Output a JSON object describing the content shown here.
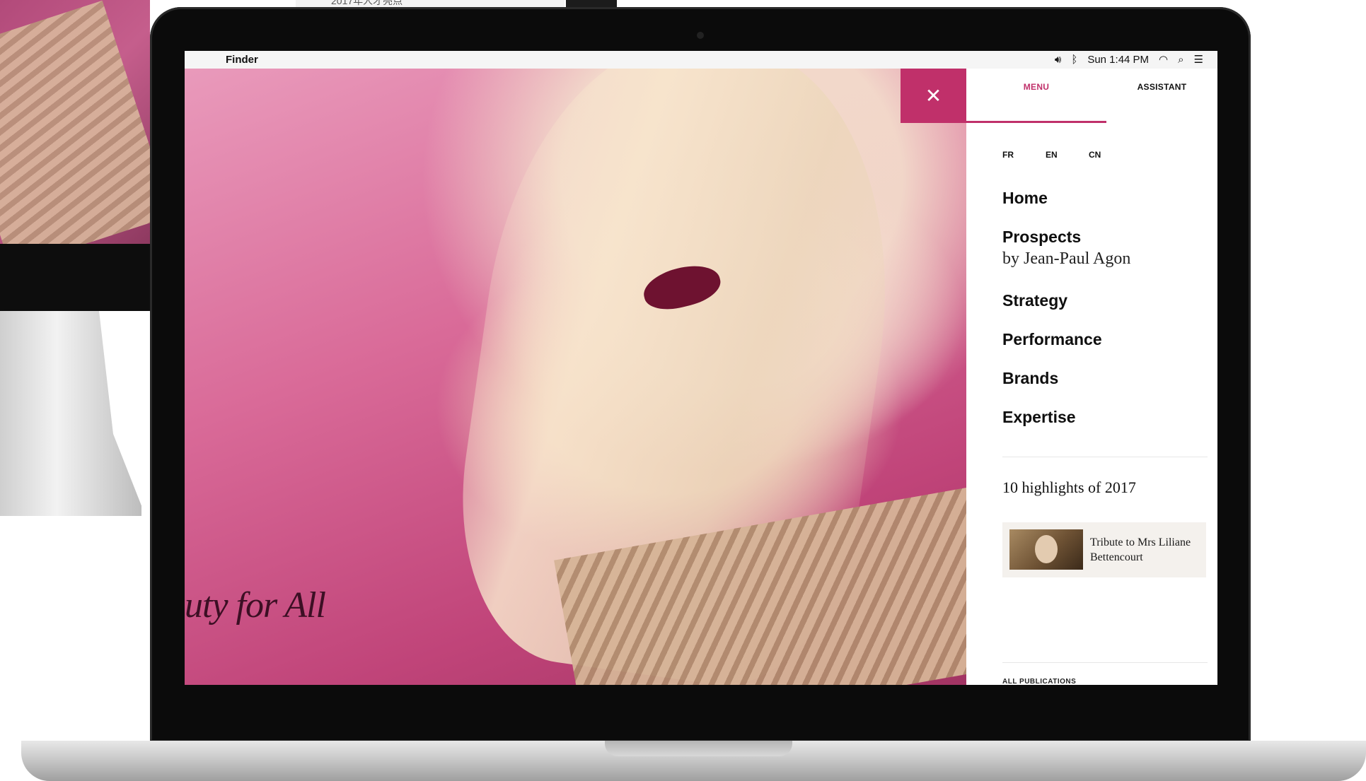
{
  "menubar": {
    "app_name": "Finder",
    "clock": "Sun 1:44 PM",
    "icons": [
      "apple-icon",
      "volume-icon",
      "bluetooth-icon",
      "wifi-icon",
      "spotlight-search-icon",
      "notification-center-icon"
    ]
  },
  "background": {
    "window_title_fragment": "2017年人才亮点"
  },
  "hero": {
    "text": "uty for All"
  },
  "panel": {
    "close_label": "✕",
    "tabs": {
      "menu": "MENU",
      "assistant": "ASSISTANT"
    },
    "languages": [
      "FR",
      "EN",
      "CN"
    ],
    "nav": [
      {
        "label": "Home"
      },
      {
        "label": "Prospects",
        "sublabel": "by Jean-Paul Agon"
      },
      {
        "label": "Strategy"
      },
      {
        "label": "Performance"
      },
      {
        "label": "Brands"
      },
      {
        "label": "Expertise"
      }
    ],
    "highlights_title": "10 highlights of 2017",
    "card_title": "Tribute to Mrs Liliane Bettencourt",
    "footer_fragment": "ALL PUBLICATIONS"
  },
  "colors": {
    "accent": "#c0306a",
    "hero_pink": "#d96a98",
    "panel_bg": "#ffffff",
    "card_bg": "#f4f1ed"
  }
}
